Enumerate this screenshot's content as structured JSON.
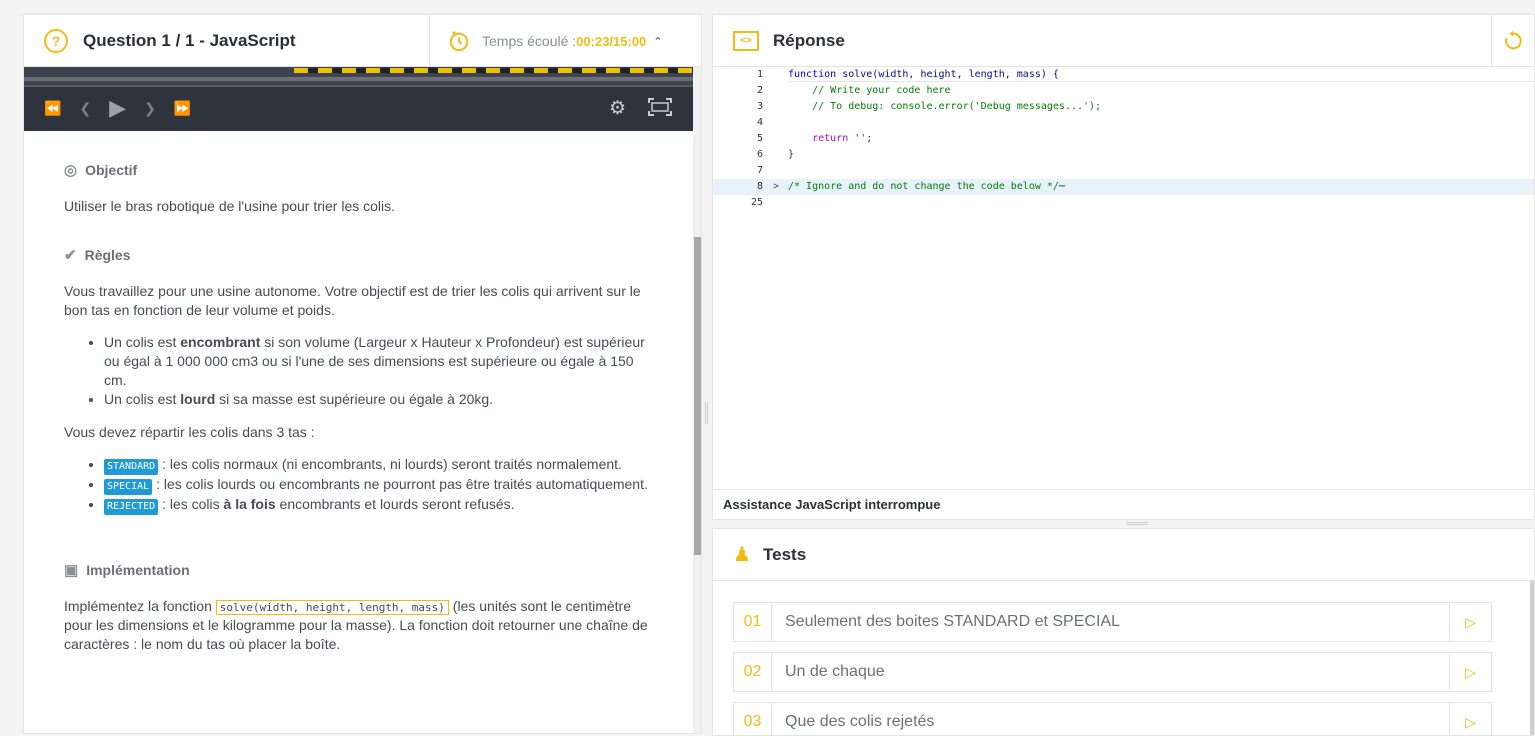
{
  "question": {
    "title": "Question 1 / 1 - JavaScript",
    "timer_label": "Temps écoulé : ",
    "timer_value": "00:23/15:00"
  },
  "objective": {
    "title": "Objectif",
    "text": "Utiliser le bras robotique de l'usine pour trier les colis."
  },
  "rules": {
    "title": "Règles",
    "intro": "Vous travaillez pour une usine autonome. Votre objectif est de trier les colis qui arrivent sur le bon tas en fonction de leur volume et poids.",
    "item1_pre": "Un colis est ",
    "item1_bold": "encombrant",
    "item1_post": " si son volume (Largeur x Hauteur x Profondeur) est supérieur ou égal à 1 000 000 cm3 ou si l'une de ses dimensions est supérieure ou égale à 150 cm.",
    "item2_pre": "Un colis est ",
    "item2_bold": "lourd",
    "item2_post": " si sa masse est supérieure ou égale à 20kg.",
    "split_intro": "Vous devez répartir les colis dans 3 tas :",
    "stack1_tag": "STANDARD",
    "stack1_text": " : les colis normaux (ni encombrants, ni lourds) seront traités normalement.",
    "stack2_tag": "SPECIAL",
    "stack2_text": " : les colis lourds ou encombrants ne pourront pas être traités automatiquement.",
    "stack3_tag": "REJECTED",
    "stack3_pre": " : les colis ",
    "stack3_bold": "à la fois",
    "stack3_post": " encombrants et lourds seront refusés."
  },
  "implementation": {
    "title": "Implémentation",
    "pre": "Implémentez la fonction ",
    "code": "solve(width, height, length, mass)",
    "post": " (les unités sont le centimètre pour les dimensions et le kilogramme pour la masse). La fonction doit retourner une chaîne de caractères : le nom du tas où placer la boîte."
  },
  "answer": {
    "title": "Réponse",
    "status": "Assistance JavaScript interrompue",
    "line_numbers": [
      "1",
      "2",
      "3",
      "4",
      "5",
      "6",
      "7",
      "8",
      "25"
    ],
    "code": {
      "l1_kw": "function",
      "l1_rest": " solve(width, height, length, mass) {",
      "l2": "    // Write your code here",
      "l3": "    // To debug: console.error('Debug messages...');",
      "l5_kw": "return",
      "l5_str": "''",
      "l5_end": ";",
      "l6": "}",
      "l8": "/* Ignore and do not change the code below */",
      "l8_ellipsis": "⋯"
    }
  },
  "tests": {
    "title": "Tests",
    "items": [
      {
        "num": "01",
        "name": "Seulement des boites STANDARD et SPECIAL"
      },
      {
        "num": "02",
        "name": "Un de chaque"
      },
      {
        "num": "03",
        "name": "Que des colis rejetés"
      }
    ]
  },
  "colors": {
    "accent": "#f2bb13",
    "tag_blue": "#1f9ad6"
  },
  "icons": [
    "question-icon",
    "timer-icon",
    "chevron-up-icon",
    "rewind-icon",
    "step-back-icon",
    "play-icon",
    "step-forward-icon",
    "fast-forward-icon",
    "gear-icon",
    "fullscreen-icon",
    "target-icon",
    "check-icon",
    "book-icon",
    "code-icon",
    "reset-icon",
    "tests-icon",
    "run-icon"
  ]
}
